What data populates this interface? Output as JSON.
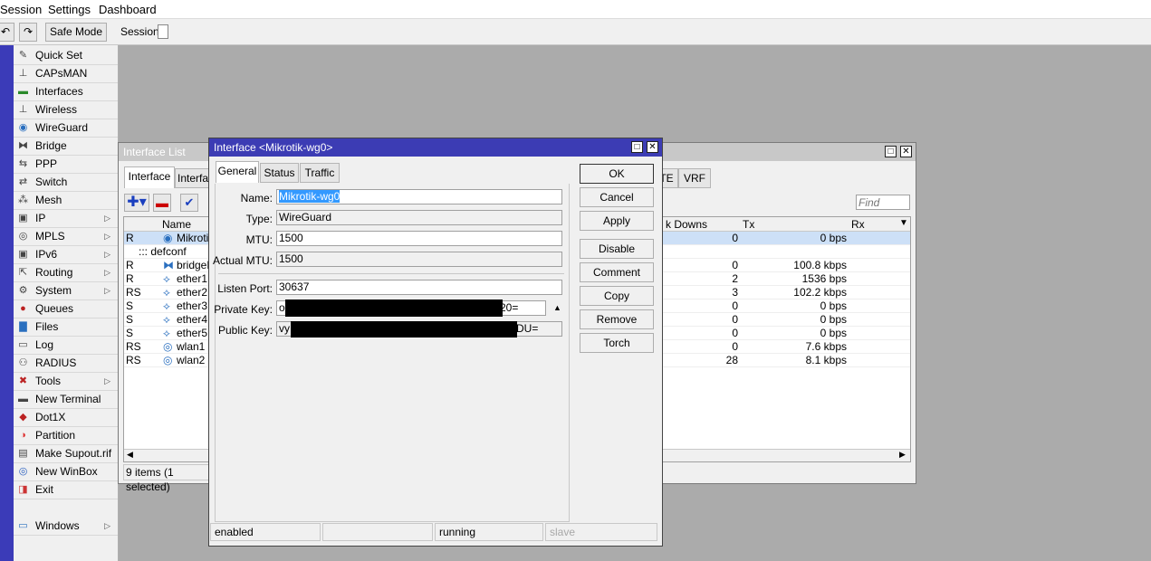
{
  "menubar": {
    "items": [
      "Session",
      "Settings",
      "Dashboard"
    ]
  },
  "toolbar": {
    "undo_icon": "undo-icon",
    "redo_icon": "redo-icon",
    "safe_mode": "Safe Mode",
    "session_label": "Session:"
  },
  "sidebar": {
    "items": [
      {
        "label": "Quick Set",
        "icon": "wand-icon",
        "sub": false
      },
      {
        "label": "CAPsMAN",
        "icon": "antenna-icon",
        "sub": false
      },
      {
        "label": "Interfaces",
        "icon": "interfaces-icon",
        "sub": false
      },
      {
        "label": "Wireless",
        "icon": "wireless-icon",
        "sub": false
      },
      {
        "label": "WireGuard",
        "icon": "wireguard-icon",
        "sub": false
      },
      {
        "label": "Bridge",
        "icon": "bridge-icon",
        "sub": false
      },
      {
        "label": "PPP",
        "icon": "ppp-icon",
        "sub": false
      },
      {
        "label": "Switch",
        "icon": "switch-icon",
        "sub": false
      },
      {
        "label": "Mesh",
        "icon": "mesh-icon",
        "sub": false
      },
      {
        "label": "IP",
        "icon": "ip-icon",
        "sub": true
      },
      {
        "label": "MPLS",
        "icon": "mpls-icon",
        "sub": true
      },
      {
        "label": "IPv6",
        "icon": "ipv6-icon",
        "sub": true
      },
      {
        "label": "Routing",
        "icon": "routing-icon",
        "sub": true
      },
      {
        "label": "System",
        "icon": "gear-icon",
        "sub": true
      },
      {
        "label": "Queues",
        "icon": "queues-icon",
        "sub": false
      },
      {
        "label": "Files",
        "icon": "folder-icon",
        "sub": false
      },
      {
        "label": "Log",
        "icon": "log-icon",
        "sub": false
      },
      {
        "label": "RADIUS",
        "icon": "radius-icon",
        "sub": false
      },
      {
        "label": "Tools",
        "icon": "tools-icon",
        "sub": true
      },
      {
        "label": "New Terminal",
        "icon": "terminal-icon",
        "sub": false
      },
      {
        "label": "Dot1X",
        "icon": "dot1x-icon",
        "sub": false
      },
      {
        "label": "Partition",
        "icon": "partition-icon",
        "sub": false
      },
      {
        "label": "Make Supout.rif",
        "icon": "supout-icon",
        "sub": false
      },
      {
        "label": "New WinBox",
        "icon": "winbox-icon",
        "sub": false
      },
      {
        "label": "Exit",
        "icon": "exit-icon",
        "sub": false
      },
      {
        "label": "Windows",
        "icon": "windows-icon",
        "sub": true
      }
    ]
  },
  "iface_list": {
    "title": "Interface List",
    "tabs": [
      "Interface",
      "Interfa"
    ],
    "right_tabs": [
      "TE",
      "VRF"
    ],
    "find_placeholder": "Find",
    "columns": {
      "name": "Name",
      "link_downs": "k Downs",
      "tx": "Tx",
      "rx": "Rx"
    },
    "rows": [
      {
        "flag": "R",
        "name": "Mikrotik",
        "icon": "wireguard-icon",
        "downs": "0",
        "tx": "0 bps",
        "selected": true
      },
      {
        "flag": "",
        "name": "::: defconf",
        "icon": "",
        "downs": "",
        "tx": "",
        "comment": true
      },
      {
        "flag": "R",
        "name": "bridgeL",
        "icon": "bridge-icon",
        "downs": "0",
        "tx": "100.8 kbps"
      },
      {
        "flag": "R",
        "name": "ether1",
        "icon": "ethernet-icon",
        "downs": "2",
        "tx": "1536 bps"
      },
      {
        "flag": "RS",
        "name": "ether2",
        "icon": "ethernet-icon",
        "downs": "3",
        "tx": "102.2 kbps"
      },
      {
        "flag": "S",
        "name": "ether3",
        "icon": "ethernet-icon",
        "downs": "0",
        "tx": "0 bps"
      },
      {
        "flag": "S",
        "name": "ether4",
        "icon": "ethernet-icon",
        "downs": "0",
        "tx": "0 bps"
      },
      {
        "flag": "S",
        "name": "ether5",
        "icon": "ethernet-icon",
        "downs": "0",
        "tx": "0 bps"
      },
      {
        "flag": "RS",
        "name": "wlan1",
        "icon": "wireless-icon",
        "downs": "0",
        "tx": "7.6 kbps"
      },
      {
        "flag": "RS",
        "name": "wlan2",
        "icon": "wireless-icon",
        "downs": "28",
        "tx": "8.1 kbps"
      }
    ],
    "status": "9 items (1 selected)"
  },
  "dialog": {
    "title": "Interface <Mikrotik-wg0>",
    "tabs": [
      "General",
      "Status",
      "Traffic"
    ],
    "fields": {
      "name_label": "Name:",
      "name": "Mikrotik-wg0",
      "type_label": "Type:",
      "type": "WireGuard",
      "mtu_label": "MTU:",
      "mtu": "1500",
      "actual_mtu_label": "Actual MTU:",
      "actual_mtu": "1500",
      "listen_port_label": "Listen Port:",
      "listen_port": "30637",
      "private_key_label": "Private Key:",
      "private_key_start": "o",
      "private_key_end": "20=",
      "public_key_label": "Public Key:",
      "public_key_start": "vy",
      "public_key_end": "DU="
    },
    "buttons": [
      "OK",
      "Cancel",
      "Apply",
      "Disable",
      "Comment",
      "Copy",
      "Remove",
      "Torch"
    ],
    "status": [
      "enabled",
      "",
      "running",
      "slave"
    ]
  }
}
